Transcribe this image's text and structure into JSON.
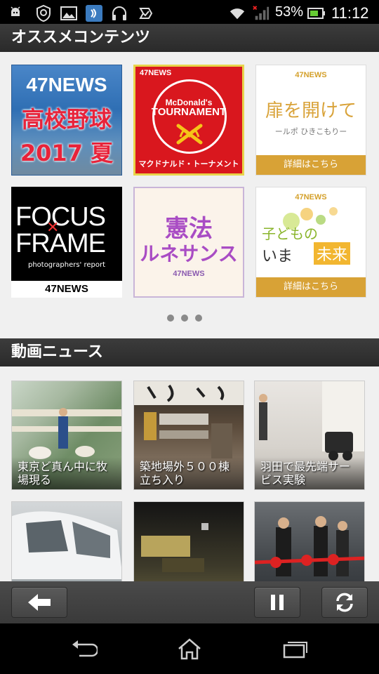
{
  "status_bar": {
    "battery_percent": "53%",
    "time": "11:12",
    "icons": [
      "android-debug-icon",
      "shield-icon",
      "image-icon",
      "nfc-icon",
      "headphones-icon",
      "check-icon",
      "wifi-icon",
      "signal-icon",
      "battery-icon"
    ]
  },
  "sections": {
    "recommended_title": "オススメコンテンツ",
    "video_news_title": "動画ニュース"
  },
  "recommended": {
    "tiles": [
      {
        "name": "koushien",
        "brand": "47NEWS",
        "line1": "高校野球",
        "line2": "2017 夏"
      },
      {
        "name": "mcdonalds-tournament",
        "brand": "47NEWS",
        "line1": "McDonald's",
        "line2": "TOURNAMENT",
        "line3": "マクドナルド・トーナメント"
      },
      {
        "name": "tobira",
        "brand": "47NEWS",
        "line1": "扉を開けて",
        "line2": "ールポ ひきこもりー",
        "button": "詳細はこちら"
      },
      {
        "name": "focus-frame",
        "line1": "FOCUS",
        "line2": "FRAME",
        "line3": "photographers' report",
        "brand": "47NEWS"
      },
      {
        "name": "kenpo",
        "line1": "憲法",
        "line2": "ルネサンス",
        "brand": "47NEWS"
      },
      {
        "name": "kodomo",
        "brand": "47NEWS",
        "line1": "子どもの",
        "line2": "いま",
        "line3": "未来",
        "button": "詳細はこちら"
      }
    ],
    "page_dots": 3
  },
  "video_news": [
    {
      "caption": "東京ど真ん中に牧場現る"
    },
    {
      "caption": "築地場外５００棟立ち入り"
    },
    {
      "caption": "羽田で最先端サービス実験"
    },
    {
      "caption": ""
    },
    {
      "caption": ""
    },
    {
      "caption": ""
    }
  ],
  "toolbar": {
    "back_icon": "arrow-left-icon",
    "pause_icon": "pause-icon",
    "refresh_icon": "refresh-icon"
  },
  "nav_bar": {
    "icons": [
      "back-icon",
      "home-icon",
      "recent-apps-icon"
    ]
  },
  "colors": {
    "header_bg": "#333333",
    "accent_red": "#d9171e",
    "accent_gold": "#d8a236"
  }
}
